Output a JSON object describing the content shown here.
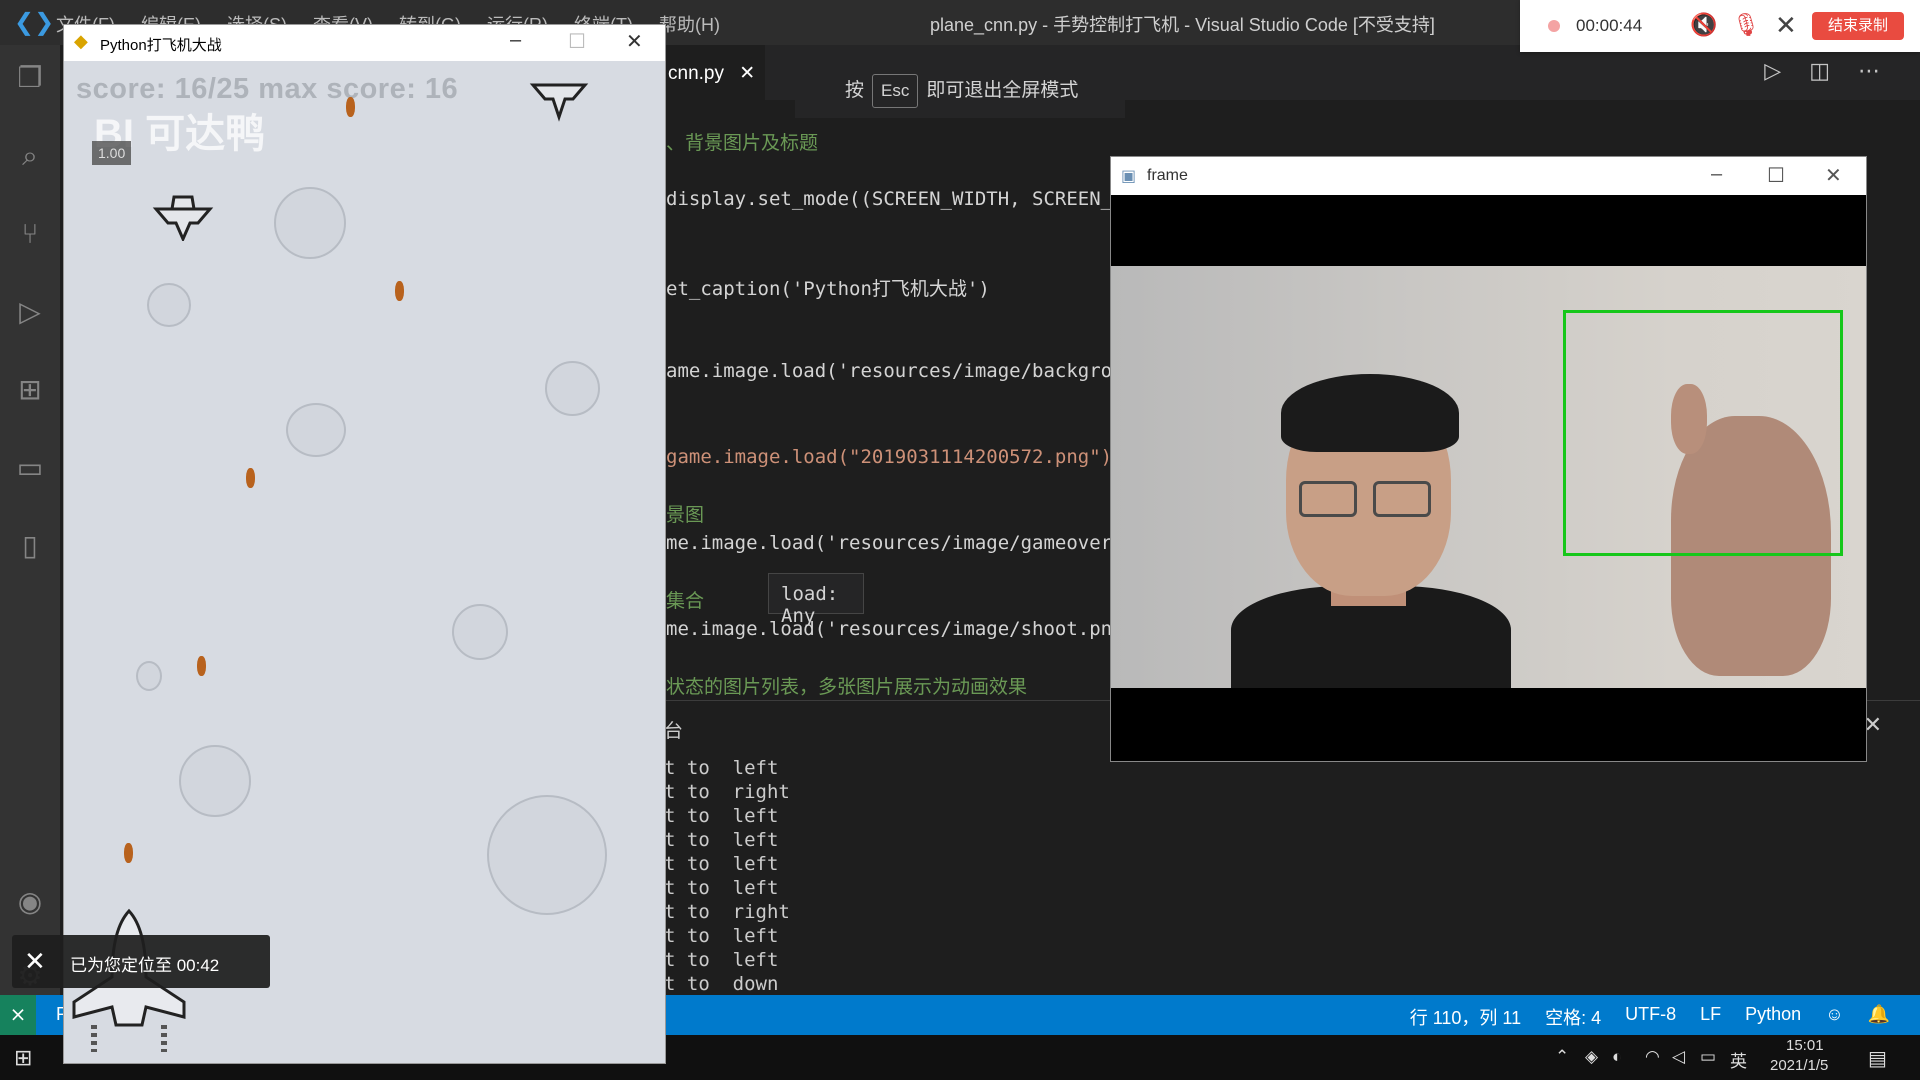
{
  "vscode": {
    "window_title": "plane_cnn.py - 手势控制打飞机 - Visual Studio Code [不受支持]",
    "menu": [
      "文件(F)",
      "编辑(E)",
      "选择(S)",
      "查看(V)",
      "转到(G)",
      "运行(R)",
      "终端(T)",
      "帮助(H)"
    ],
    "active_tab": "cnn.py",
    "esc_banner": {
      "prefix": "按",
      "key": "Esc",
      "suffix": "即可退出全屏模式"
    },
    "code_lines": [
      {
        "text": "、背景图片及标题",
        "kind": "comment"
      },
      {
        "text": "display.set_mode((SCREEN_WIDTH, SCREEN_",
        "kind": "code"
      },
      {
        "text": "et_caption('Python打飞机大战')",
        "kind": "code"
      },
      {
        "text": "ame.image.load('resources/image/backgro",
        "kind": "code"
      },
      {
        "text": "game.image.load(\"2019031114200572.png\")",
        "kind": "code"
      },
      {
        "text": "景图",
        "kind": "comment"
      },
      {
        "text": "me.image.load('resources/image/gameover",
        "kind": "code"
      },
      {
        "text": "集合",
        "kind": "comment"
      },
      {
        "text": "me.image.load('resources/image/shoot.pn",
        "kind": "code"
      },
      {
        "text": "状态的图片列表，多张图片展示为动画效果",
        "kind": "comment"
      }
    ],
    "hover_tooltip": "load: Any",
    "panel_title": "台",
    "terminal_lines": [
      "t to  left",
      "t to  right",
      "t to  left",
      "t to  left",
      "t to  left",
      "t to  left",
      "t to  right",
      "t to  left",
      "t to  left",
      "t to  down"
    ],
    "status_left": "P",
    "status": {
      "position": "行 110，列 11",
      "spaces": "空格: 4",
      "encoding": "UTF-8",
      "eol": "LF",
      "language": "Python"
    }
  },
  "recorder": {
    "elapsed": "00:00:44",
    "end_button": "结束录制"
  },
  "game": {
    "window_title": "Python打飞机大战",
    "score_text": "score: 16/25  max score: 16",
    "watermark": "BI 可达鸭",
    "version": "1.00"
  },
  "toast": {
    "message": "已为您定位至 00:42"
  },
  "frame": {
    "window_title": "frame"
  },
  "taskbar": {
    "ime": "英",
    "time": "15:01",
    "date": "2021/1/5"
  },
  "colors": {
    "status_bar": "#007acc",
    "roi_box": "#16c71a",
    "record_button": "#e94b40",
    "bullet": "#b8621d"
  },
  "icons": {
    "activity": [
      "explorer-icon",
      "search-icon",
      "source-control-icon",
      "run-debug-icon",
      "extensions-icon",
      "remote-explorer-icon",
      "notebook-icon",
      "account-icon",
      "settings-gear-icon"
    ]
  }
}
